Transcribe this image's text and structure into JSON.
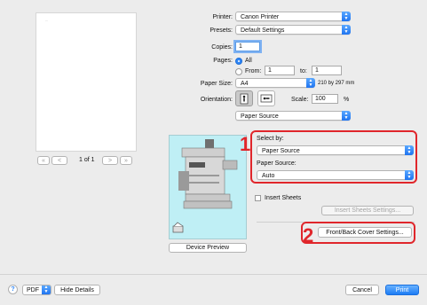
{
  "preview": {
    "page_text": "...",
    "page_indicator": "1 of 1",
    "nav_first": "«",
    "nav_prev": "<",
    "nav_next": ">",
    "nav_last": "»"
  },
  "form": {
    "printer_label": "Printer:",
    "printer_value": "Canon Printer",
    "presets_label": "Presets:",
    "presets_value": "Default Settings",
    "copies_label": "Copies:",
    "copies_value": "1",
    "pages_label": "Pages:",
    "pages_all": "All",
    "pages_from": "From:",
    "pages_from_value": "1",
    "pages_to": "to:",
    "pages_to_value": "1",
    "paper_size_label": "Paper Size:",
    "paper_size_value": "A4",
    "paper_size_dims": "210 by 297 mm",
    "orientation_label": "Orientation:",
    "scale_label": "Scale:",
    "scale_value": "100",
    "scale_unit": "%",
    "section_value": "Paper Source"
  },
  "source": {
    "select_by_label": "Select by:",
    "select_by_value": "Paper Source",
    "paper_source_label": "Paper Source:",
    "paper_source_value": "Auto",
    "insert_sheets_label": "Insert Sheets",
    "insert_sheets_button": "Insert Sheets Settings...",
    "front_back_button": "Front/Back Cover Settings...",
    "device_preview_button": "Device Preview"
  },
  "annotations": {
    "one": "1",
    "two": "2"
  },
  "footer": {
    "help": "?",
    "pdf_label": "PDF",
    "hide_details": "Hide Details",
    "cancel": "Cancel",
    "print": "Print"
  },
  "colors": {
    "accent": "#1f74f0",
    "annotation": "#e0262b",
    "device_bg": "#bfeff5"
  }
}
